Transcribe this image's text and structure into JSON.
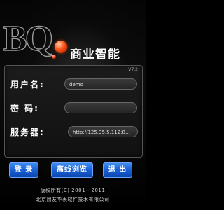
{
  "logo": {
    "mark": "BQ",
    "product": "商业智能"
  },
  "form": {
    "version": "V7.2",
    "username_label": "用户名:",
    "username_value": "demo",
    "password_label": "密  码:",
    "password_value": "",
    "server_label": "服务器:",
    "server_value": "http://125.35.5.112:8083/BISer..."
  },
  "buttons": {
    "login": "登 录",
    "offline": "离线浏览",
    "exit": "退 出"
  },
  "footer": {
    "copyright": "版权所有(C) 2001 - 2011",
    "company": "北京用友华表软件技术有限公司"
  },
  "colors": {
    "button": "#1a5fd4",
    "logo_ball": "#ff5a1a"
  }
}
